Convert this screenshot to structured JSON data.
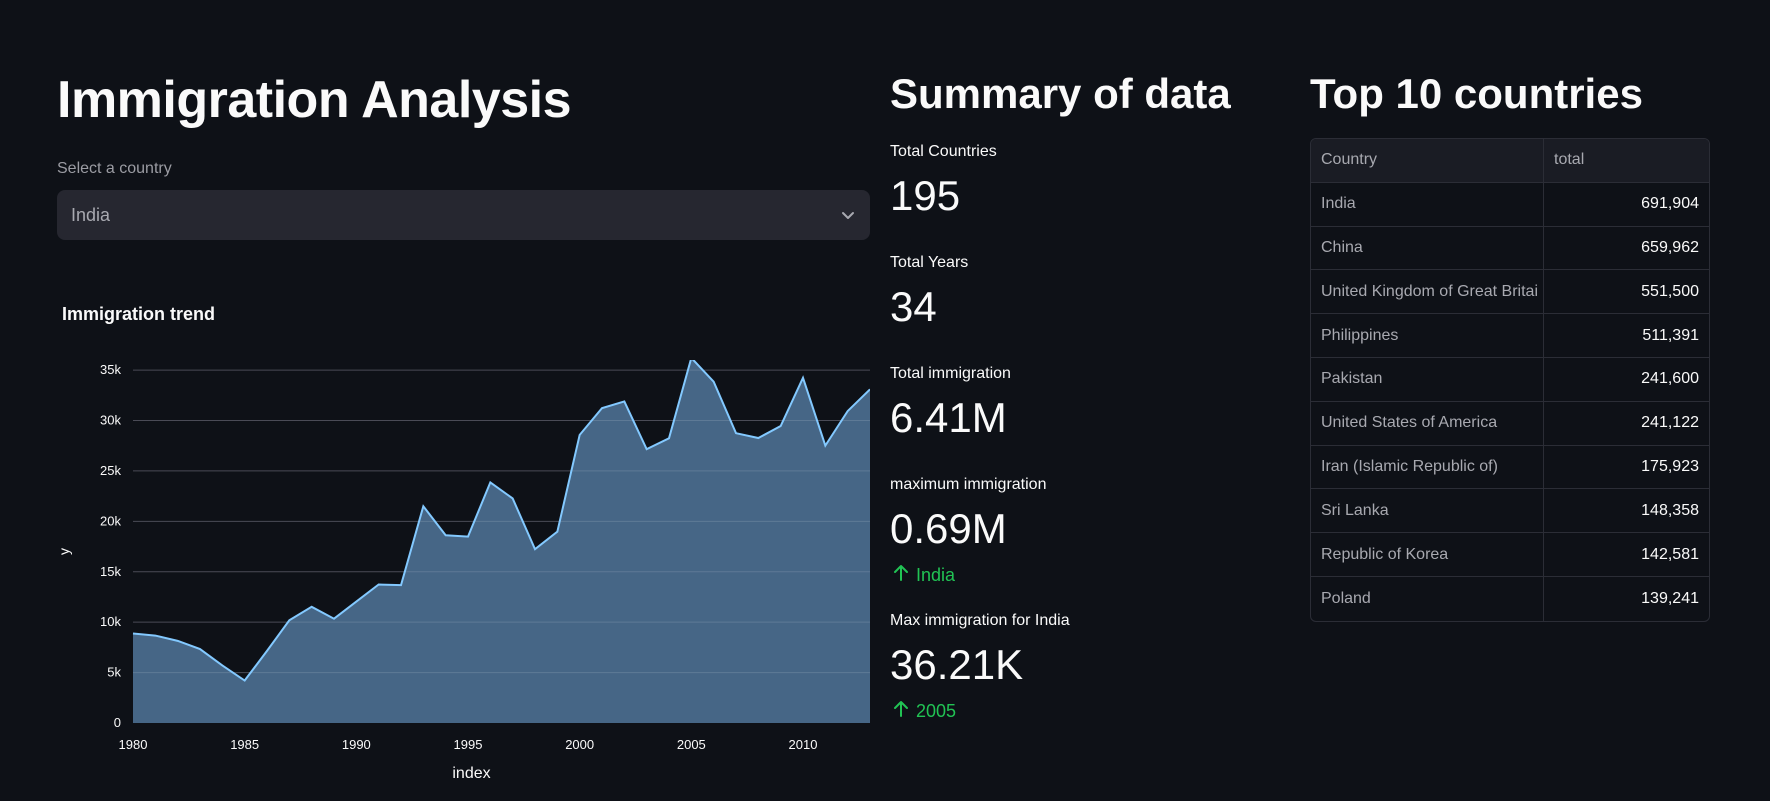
{
  "header": {
    "title": "Immigration Analysis"
  },
  "country_select": {
    "label": "Select a country",
    "value": "India"
  },
  "trend": {
    "title": "Immigration trend"
  },
  "chart_data": {
    "type": "area",
    "title": "Immigration trend",
    "xlabel": "index",
    "ylabel": "y",
    "xlim": [
      1980,
      2013
    ],
    "ylim": [
      0,
      36000
    ],
    "x_ticks": [
      1980,
      1985,
      1990,
      1995,
      2000,
      2005,
      2010
    ],
    "y_ticks": [
      0,
      5000,
      10000,
      15000,
      20000,
      25000,
      30000,
      35000
    ],
    "y_tick_labels": [
      "0",
      "5k",
      "10k",
      "15k",
      "20k",
      "25k",
      "30k",
      "35k"
    ],
    "x": [
      1980,
      1981,
      1982,
      1983,
      1984,
      1985,
      1986,
      1987,
      1988,
      1989,
      1990,
      1991,
      1992,
      1993,
      1994,
      1995,
      1996,
      1997,
      1998,
      1999,
      2000,
      2001,
      2002,
      2003,
      2004,
      2005,
      2006,
      2007,
      2008,
      2009,
      2010,
      2011,
      2012,
      2013
    ],
    "y": [
      8880,
      8670,
      8147,
      7338,
      5704,
      4211,
      7150,
      10189,
      11522,
      10343,
      12041,
      13734,
      13673,
      21496,
      18620,
      18489,
      23859,
      22268,
      17241,
      18974,
      28572,
      31223,
      31889,
      27155,
      28235,
      36210,
      33848,
      28742,
      28261,
      29456,
      34235,
      27509,
      30933,
      33087
    ],
    "line_color": "#83c9ff",
    "fill_color": "#4a6b8c",
    "grid": true
  },
  "summary": {
    "title": "Summary of data",
    "metrics": [
      {
        "label": "Total Countries",
        "value": "195"
      },
      {
        "label": "Total Years",
        "value": "34"
      },
      {
        "label": "Total immigration",
        "value": "6.41M"
      },
      {
        "label": "maximum immigration",
        "value": "0.69M",
        "delta": "India"
      },
      {
        "label": "Max immigration for India",
        "value": "36.21K",
        "delta": "2005"
      }
    ],
    "delta_color": "#21c354"
  },
  "top10": {
    "title": "Top 10 countries",
    "columns": [
      "Country",
      "total"
    ],
    "rows": [
      [
        "India",
        "691,904"
      ],
      [
        "China",
        "659,962"
      ],
      [
        "United Kingdom of Great Britai",
        "551,500"
      ],
      [
        "Philippines",
        "511,391"
      ],
      [
        "Pakistan",
        "241,600"
      ],
      [
        "United States of America",
        "241,122"
      ],
      [
        "Iran (Islamic Republic of)",
        "175,923"
      ],
      [
        "Sri Lanka",
        "148,358"
      ],
      [
        "Republic of Korea",
        "142,581"
      ],
      [
        "Poland",
        "139,241"
      ]
    ]
  }
}
